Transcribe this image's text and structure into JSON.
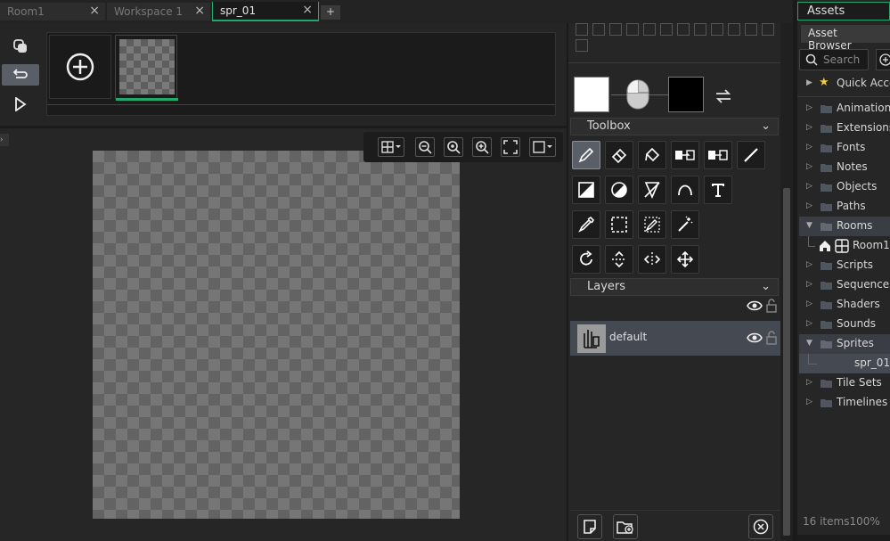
{
  "tabs": [
    {
      "label": "Room1",
      "close": "×"
    },
    {
      "label": "Workspace 1",
      "close": "×"
    },
    {
      "label": "spr_01",
      "close": "×"
    }
  ],
  "tab_add": "+",
  "toolbox": {
    "title": "Toolbox"
  },
  "layers": {
    "title": "Layers",
    "items": [
      {
        "name": "default"
      }
    ]
  },
  "assets": {
    "title": "Assets",
    "browser_tab": "Asset Browser",
    "search_placeholder": "Search",
    "quick_access": "Quick Access",
    "groups": [
      {
        "label": "Animation Curves"
      },
      {
        "label": "Extensions"
      },
      {
        "label": "Fonts"
      },
      {
        "label": "Notes"
      },
      {
        "label": "Objects"
      },
      {
        "label": "Paths"
      },
      {
        "label": "Rooms"
      },
      {
        "label": "Scripts"
      },
      {
        "label": "Sequences"
      },
      {
        "label": "Shaders"
      },
      {
        "label": "Sounds"
      },
      {
        "label": "Sprites"
      },
      {
        "label": "Tile Sets"
      },
      {
        "label": "Timelines"
      }
    ],
    "room_child": "Room1",
    "sprite_child": "spr_01",
    "footer_items": "16 items",
    "footer_zoom": "100%"
  },
  "colors": {
    "accent": "#22a86a",
    "primary_color": "#ffffff",
    "secondary_color": "#000000"
  }
}
